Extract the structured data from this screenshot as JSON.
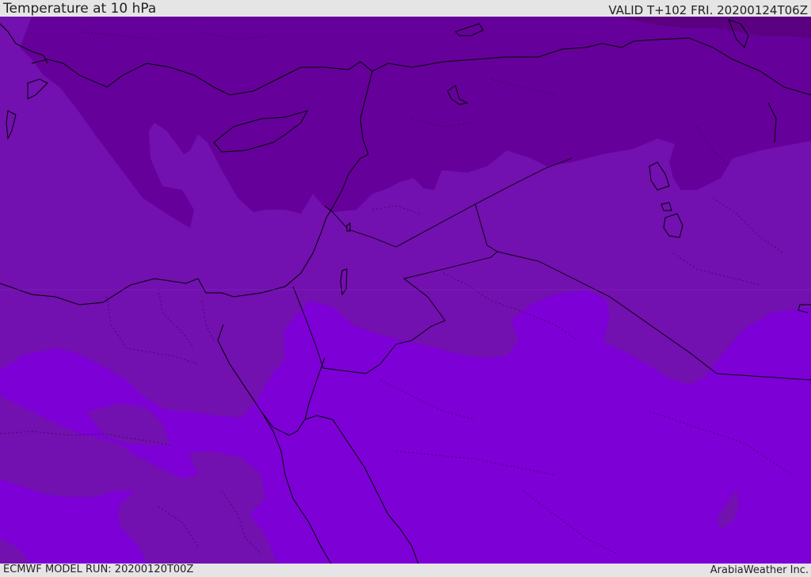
{
  "header": {
    "title": "Temperature at 10 hPa",
    "valid": "VALID T+102 FRI. 20200124T06Z"
  },
  "footer": {
    "model_run": "ECMWF MODEL RUN: 20200120T00Z",
    "credit": "ArabiaWeather Inc."
  },
  "palette": {
    "darkest": "#5a0080",
    "dark": "#66009a",
    "mid": "#7310b0",
    "light": "#7d00d6",
    "coast": "#000000"
  }
}
